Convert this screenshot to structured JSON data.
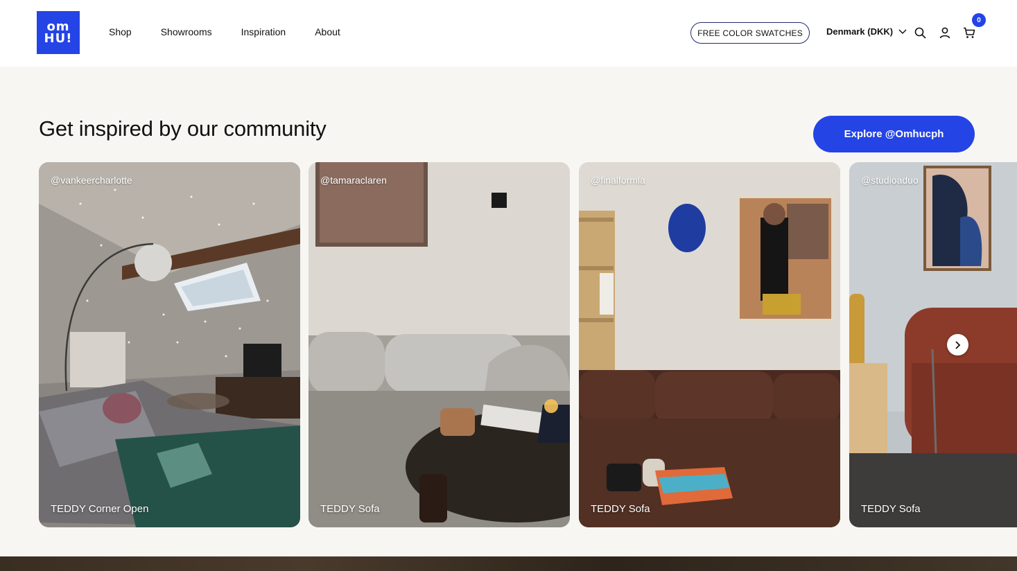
{
  "logo": {
    "line1": "om",
    "line2": "HU!"
  },
  "nav": [
    {
      "label": "Shop"
    },
    {
      "label": "Showrooms"
    },
    {
      "label": "Inspiration"
    },
    {
      "label": "About"
    }
  ],
  "header": {
    "swatches_label": "FREE COLOR SWATCHES",
    "country_label": "Denmark (DKK)",
    "cart_count": "0"
  },
  "section": {
    "title": "Get inspired by our community",
    "explore_label": "Explore @Omhucph"
  },
  "cards": [
    {
      "handle": "@vankeercharlotte",
      "product": "TEDDY Corner Open"
    },
    {
      "handle": "@tamaraclaren",
      "product": "TEDDY Sofa"
    },
    {
      "handle": "@finalformla",
      "product": "TEDDY Sofa"
    },
    {
      "handle": "@studioaduo",
      "product": "TEDDY Sofa"
    }
  ],
  "colors": {
    "accent": "#2444e6",
    "background": "#f7f6f2"
  },
  "icons": [
    "chevron-down-icon",
    "search-icon",
    "user-icon",
    "cart-icon",
    "chevron-right-icon"
  ]
}
